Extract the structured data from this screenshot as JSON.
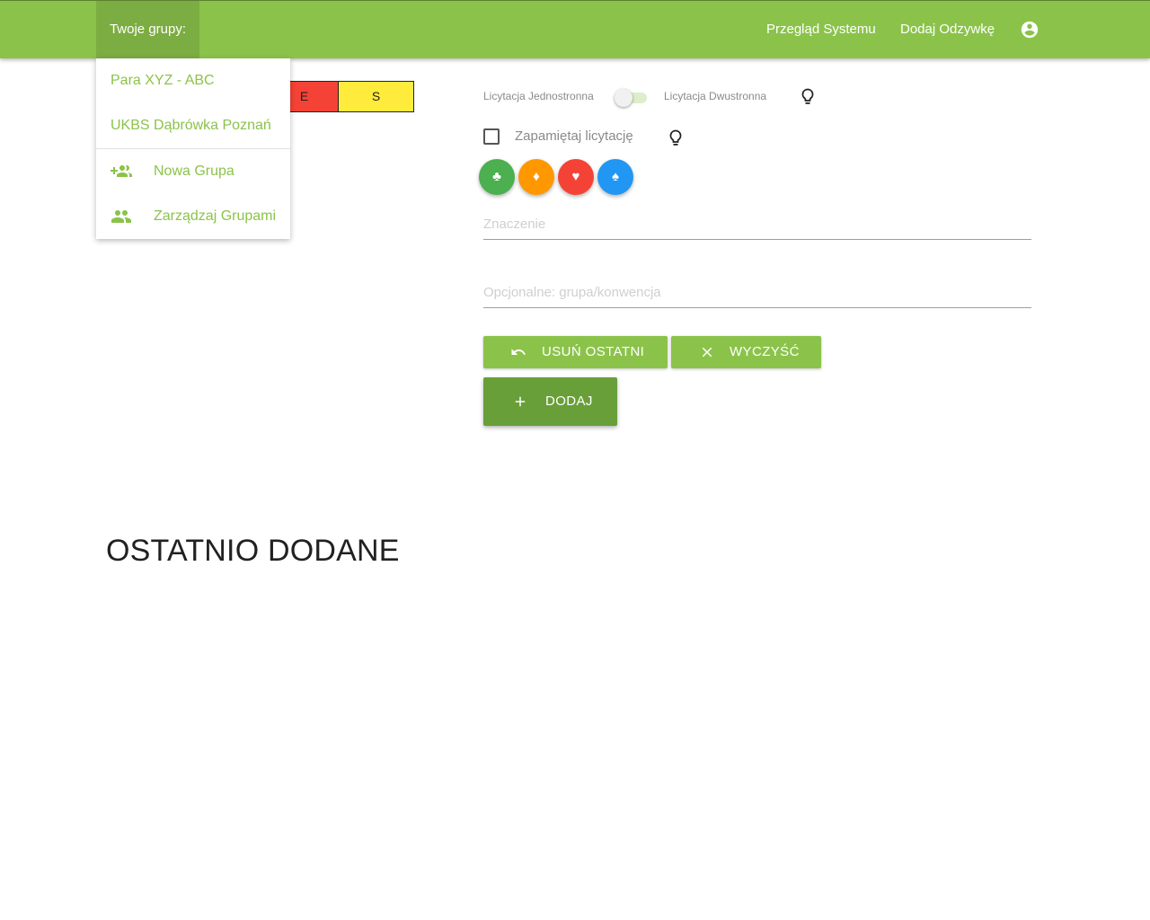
{
  "topbar": {
    "groups_label": "Twoje grupy:",
    "nav": {
      "overview_label": "Przegląd Systemu",
      "add_response_label": "Dodaj Odzywkę"
    },
    "account_icon": "account-circle-icon",
    "color": "#8bc34a"
  },
  "groups_dropdown": {
    "groups": [
      {
        "label": "Para XYZ - ABC"
      },
      {
        "label": "UKBS Dąbrówka Poznań"
      }
    ],
    "actions": [
      {
        "label": "Nowa Grupa",
        "icon": "group-add-icon"
      },
      {
        "label": "Zarządzaj Grupami",
        "icon": "group-icon"
      }
    ]
  },
  "board": {
    "cells": [
      {
        "label": "E",
        "color": "#f44336"
      },
      {
        "label": "S",
        "color": "#ffeb3b"
      }
    ]
  },
  "bidding": {
    "one_sided_label": "Licytacja Jednostronna",
    "two_sided_label": "Licytacja Dwustronna",
    "two_sided_enabled": false,
    "remember_label": "Zapamiętaj licytację",
    "remember_checked": false,
    "suits": [
      {
        "symbol": "♣",
        "name": "clubs",
        "color": "#4caf50"
      },
      {
        "symbol": "♦",
        "name": "diamonds",
        "color": "#ff9800"
      },
      {
        "symbol": "♥",
        "name": "hearts",
        "color": "#f44336"
      },
      {
        "symbol": "♠",
        "name": "spades",
        "color": "#2196f3"
      }
    ],
    "meaning_placeholder": "Znaczenie",
    "meaning_value": "",
    "group_placeholder": "Opcjonalne: grupa/konwencja",
    "group_value": "",
    "buttons": {
      "undo_label": "USUŃ OSTATNI",
      "clear_label": "WYCZYŚĆ",
      "add_label": "DODAJ"
    }
  },
  "recent": {
    "title": "OSTATNIO DODANE"
  }
}
